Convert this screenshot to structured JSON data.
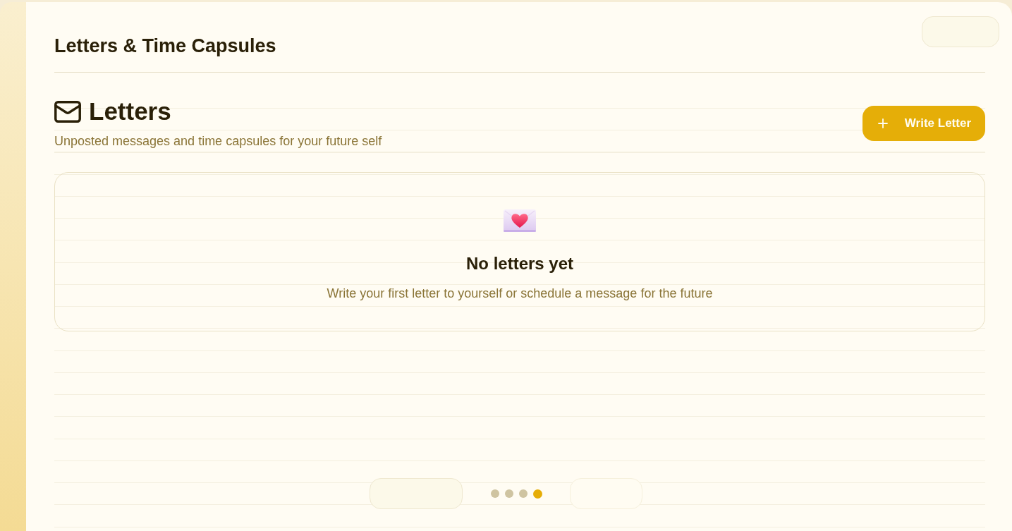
{
  "page": {
    "title": "Letters & Time Capsules"
  },
  "section": {
    "title": "Letters",
    "subtitle": "Unposted messages and time capsules for your future self",
    "action": "Write Letter"
  },
  "empty_state": {
    "title": "No letters yet",
    "message": "Write your first letter to yourself or schedule a message for the future"
  },
  "pager": {
    "buttons": [
      {
        "disabled": false
      },
      {
        "disabled": true
      }
    ],
    "dots": [
      {
        "selected": false
      },
      {
        "selected": false
      },
      {
        "selected": false
      },
      {
        "selected": true
      }
    ]
  }
}
